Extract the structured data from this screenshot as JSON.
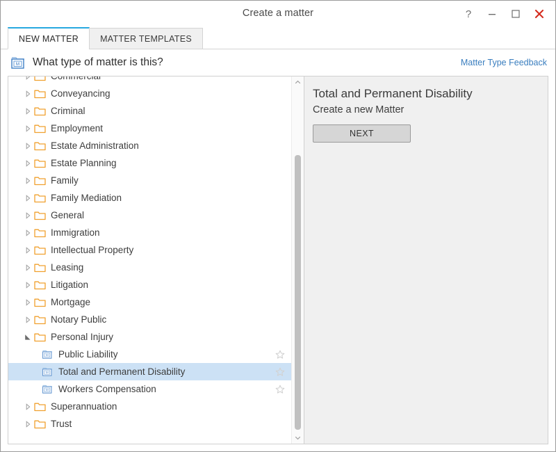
{
  "window": {
    "title": "Create a matter",
    "controls": [
      {
        "name": "help-button",
        "glyph": "?"
      },
      {
        "name": "minimize-button",
        "glyph": "—"
      },
      {
        "name": "maximize-button",
        "glyph": "□"
      },
      {
        "name": "close-button",
        "glyph": "✕"
      }
    ]
  },
  "tabs": [
    {
      "label": "NEW MATTER",
      "active": true
    },
    {
      "label": "MATTER TEMPLATES",
      "active": false
    }
  ],
  "question": {
    "icon": "matter-folder-icon",
    "text": "What type of matter is this?",
    "feedback_link": "Matter Type Feedback"
  },
  "tree": {
    "nodes": [
      {
        "label": "Commercial",
        "type": "folder",
        "level": 0,
        "expanded": false,
        "selected": false,
        "star": false,
        "clipped": true
      },
      {
        "label": "Conveyancing",
        "type": "folder",
        "level": 0,
        "expanded": false,
        "selected": false,
        "star": false
      },
      {
        "label": "Criminal",
        "type": "folder",
        "level": 0,
        "expanded": false,
        "selected": false,
        "star": false
      },
      {
        "label": "Employment",
        "type": "folder",
        "level": 0,
        "expanded": false,
        "selected": false,
        "star": false
      },
      {
        "label": "Estate Administration",
        "type": "folder",
        "level": 0,
        "expanded": false,
        "selected": false,
        "star": false
      },
      {
        "label": "Estate Planning",
        "type": "folder",
        "level": 0,
        "expanded": false,
        "selected": false,
        "star": false
      },
      {
        "label": "Family",
        "type": "folder",
        "level": 0,
        "expanded": false,
        "selected": false,
        "star": false
      },
      {
        "label": "Family Mediation",
        "type": "folder",
        "level": 0,
        "expanded": false,
        "selected": false,
        "star": false
      },
      {
        "label": "General",
        "type": "folder",
        "level": 0,
        "expanded": false,
        "selected": false,
        "star": false
      },
      {
        "label": "Immigration",
        "type": "folder",
        "level": 0,
        "expanded": false,
        "selected": false,
        "star": false
      },
      {
        "label": "Intellectual Property",
        "type": "folder",
        "level": 0,
        "expanded": false,
        "selected": false,
        "star": false
      },
      {
        "label": "Leasing",
        "type": "folder",
        "level": 0,
        "expanded": false,
        "selected": false,
        "star": false
      },
      {
        "label": "Litigation",
        "type": "folder",
        "level": 0,
        "expanded": false,
        "selected": false,
        "star": false
      },
      {
        "label": "Mortgage",
        "type": "folder",
        "level": 0,
        "expanded": false,
        "selected": false,
        "star": false
      },
      {
        "label": "Notary Public",
        "type": "folder",
        "level": 0,
        "expanded": false,
        "selected": false,
        "star": false
      },
      {
        "label": "Personal Injury",
        "type": "folder",
        "level": 0,
        "expanded": true,
        "selected": false,
        "star": false
      },
      {
        "label": "Public Liability",
        "type": "matter",
        "level": 1,
        "expanded": false,
        "selected": false,
        "star": true
      },
      {
        "label": "Total and Permanent Disability",
        "type": "matter",
        "level": 1,
        "expanded": false,
        "selected": true,
        "star": true
      },
      {
        "label": "Workers Compensation",
        "type": "matter",
        "level": 1,
        "expanded": false,
        "selected": false,
        "star": true
      },
      {
        "label": "Superannuation",
        "type": "folder",
        "level": 0,
        "expanded": false,
        "selected": false,
        "star": false
      },
      {
        "label": "Trust",
        "type": "folder",
        "level": 0,
        "expanded": false,
        "selected": false,
        "star": false
      }
    ],
    "scroll_up_icon": "chevron-up-icon",
    "scroll_down_icon": "chevron-down-icon"
  },
  "detail": {
    "title": "Total and Permanent Disability",
    "subtitle": "Create a new Matter",
    "next_label": "NEXT"
  },
  "colors": {
    "accent": "#27a8e0",
    "link": "#3a7ebf",
    "selection": "#cce1f5",
    "folder": "#f0a02e",
    "matter": "#6a9fd8",
    "close": "#d42b1e",
    "panel": "#f0f0f0"
  }
}
